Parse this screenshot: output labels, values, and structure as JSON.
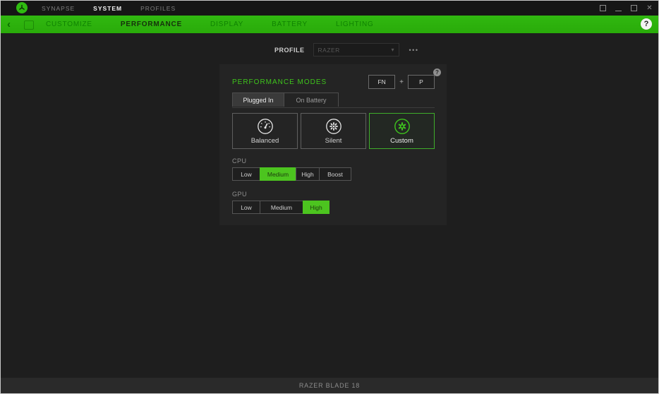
{
  "titlebar": {
    "menu": [
      {
        "label": "SYNAPSE",
        "active": false
      },
      {
        "label": "SYSTEM",
        "active": true
      },
      {
        "label": "PROFILES",
        "active": false
      }
    ]
  },
  "nav": {
    "items": [
      {
        "label": "CUSTOMIZE",
        "active": false
      },
      {
        "label": "PERFORMANCE",
        "active": true
      },
      {
        "label": "DISPLAY",
        "active": false
      },
      {
        "label": "BATTERY",
        "active": false
      },
      {
        "label": "LIGHTING",
        "active": false
      }
    ],
    "help_label": "?"
  },
  "profile": {
    "label": "PROFILE",
    "value": "RAZER",
    "menu_dots": "•••"
  },
  "panel": {
    "title": "PERFORMANCE MODES",
    "shortcut": {
      "key1": "FN",
      "plus": "+",
      "key2": "P"
    },
    "tabs": [
      {
        "label": "Plugged In",
        "active": true
      },
      {
        "label": "On Battery",
        "active": false
      }
    ],
    "modes": [
      {
        "label": "Balanced",
        "icon": "gauge-icon",
        "selected": false
      },
      {
        "label": "Silent",
        "icon": "fan-icon",
        "selected": false
      },
      {
        "label": "Custom",
        "icon": "gear-icon",
        "selected": true
      }
    ],
    "cpu": {
      "label": "CPU",
      "options": [
        {
          "label": "Low",
          "selected": false
        },
        {
          "label": "Medium",
          "selected": true
        },
        {
          "label": "High",
          "selected": false
        },
        {
          "label": "Boost",
          "selected": false
        }
      ]
    },
    "gpu": {
      "label": "GPU",
      "options": [
        {
          "label": "Low",
          "selected": false
        },
        {
          "label": "Medium",
          "selected": false
        },
        {
          "label": "High",
          "selected": true
        }
      ]
    }
  },
  "statusbar": {
    "device": "RAZER BLADE 18"
  },
  "colors": {
    "accent_green": "#44d62c",
    "banner_green": "#2eb30e",
    "panel_bg": "#242424",
    "page_bg": "#1e1e1e",
    "selected_segment": "#4cc41f"
  }
}
